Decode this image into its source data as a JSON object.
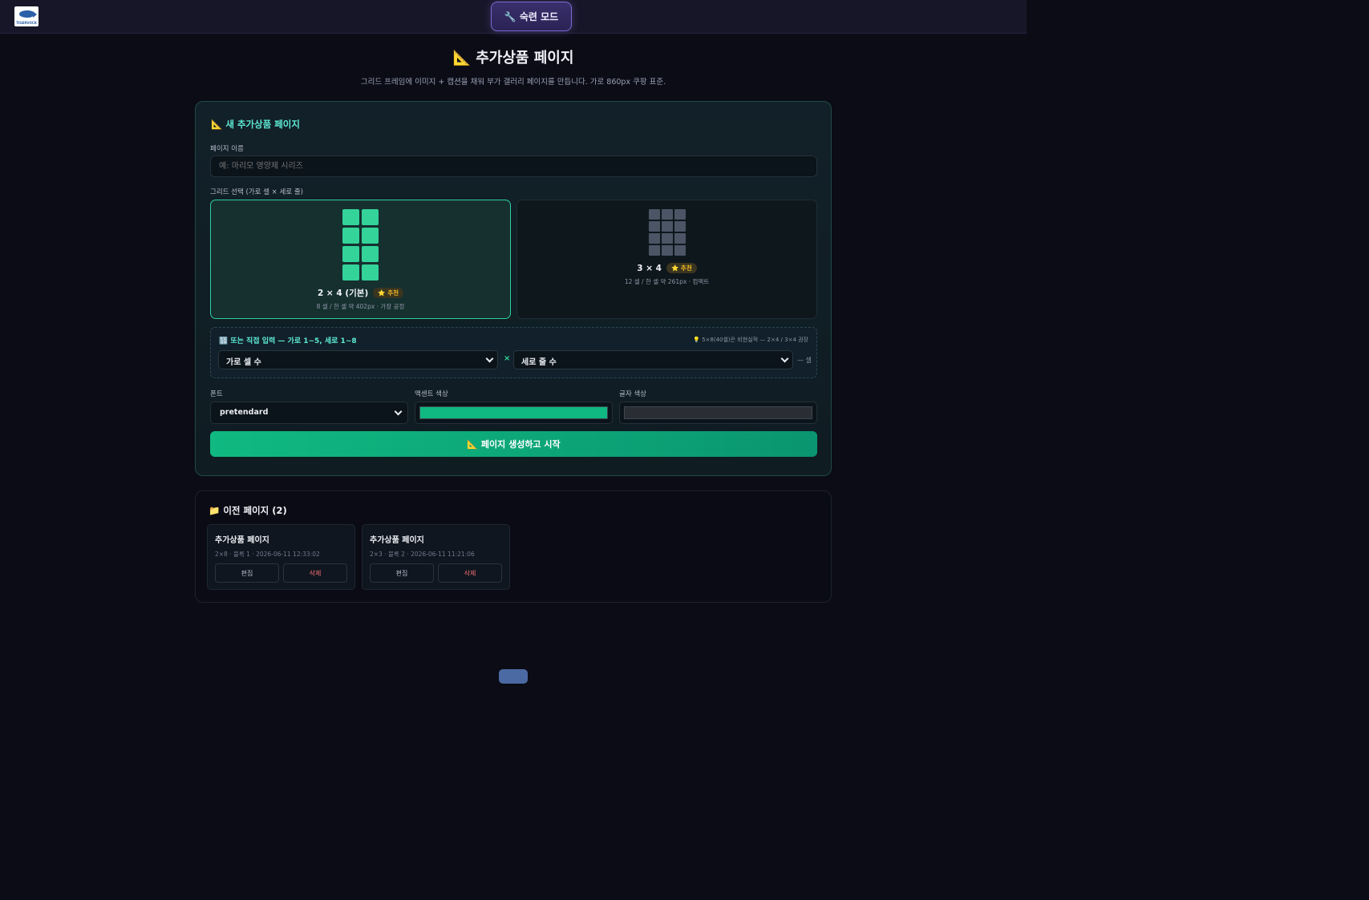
{
  "topbar": {
    "logo_text": "TIGERVOCK",
    "pro_mode_label": "🔧 숙련 모드"
  },
  "header": {
    "title": "📐 추가상품 페이지",
    "subtitle": "그리드 프레임에 이미지 + 캡션을 채워 부가 갤러리 페이지를 만듭니다. 가로 860px 쿠팡 표준."
  },
  "new_page": {
    "title": "📐 새 추가상품 페이지",
    "name_label": "페이지 이름",
    "name_placeholder": "예: 마리모 영양제 시리즈",
    "grid_label": "그리드 선택 (가로 셀 × 세로 줄)",
    "grid_options": [
      {
        "name": "2 × 4 (기본)",
        "badge": "⭐ 추천",
        "desc": "8 셀 / 한 셀 약 402px · 가장 공정",
        "selected": true
      },
      {
        "name": "3 × 4",
        "badge": "⭐ 추천",
        "desc": "12 셀 / 한 셀 약 261px · 컴팩트",
        "selected": false
      }
    ],
    "custom": {
      "title": "🔢 또는 직접 입력 — 가로 1~5, 세로 1~8",
      "hint": "💡 5×8(40셀)은 비현실적 — 2×4 / 3×4 권장",
      "cols_select": "가로 셀 수",
      "rows_select": "세로 줄 수",
      "times": "×",
      "cells_suffix": "— 셀"
    },
    "font_label": "폰트",
    "font_value": "pretendard",
    "accent_label": "액센트 색상",
    "accent_color": "#10b981",
    "text_color_label": "글자 색상",
    "text_color": "#2a2d33",
    "create_button": "📐 페이지 생성하고 시작"
  },
  "previous": {
    "title": "📁 이전 페이지 (2)",
    "items": [
      {
        "name": "추가상품 페이지",
        "meta": "2×8 · 블록 1 · 2026-06-11 12:33:02",
        "edit": "편집",
        "delete": "삭제"
      },
      {
        "name": "추가상품 페이지",
        "meta": "2×3 · 블록 2 · 2026-06-11 11:21:06",
        "edit": "편집",
        "delete": "삭제"
      }
    ]
  }
}
